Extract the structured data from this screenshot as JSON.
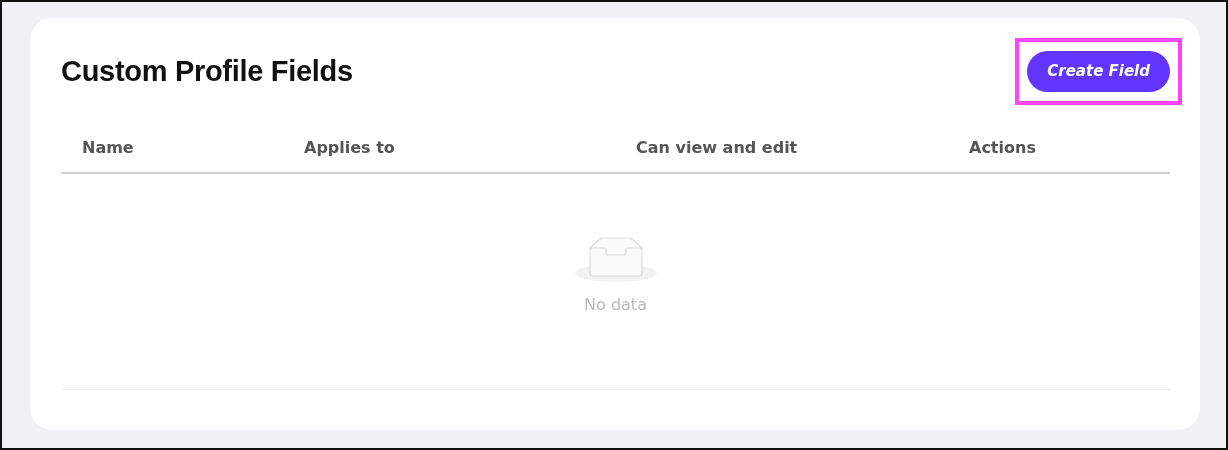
{
  "title": "Custom Profile Fields",
  "create_button": {
    "label": "Create Field",
    "highlighted": true
  },
  "table": {
    "columns": [
      "Name",
      "Applies to",
      "Can view and edit",
      "Actions"
    ],
    "empty_text": "No data"
  }
}
